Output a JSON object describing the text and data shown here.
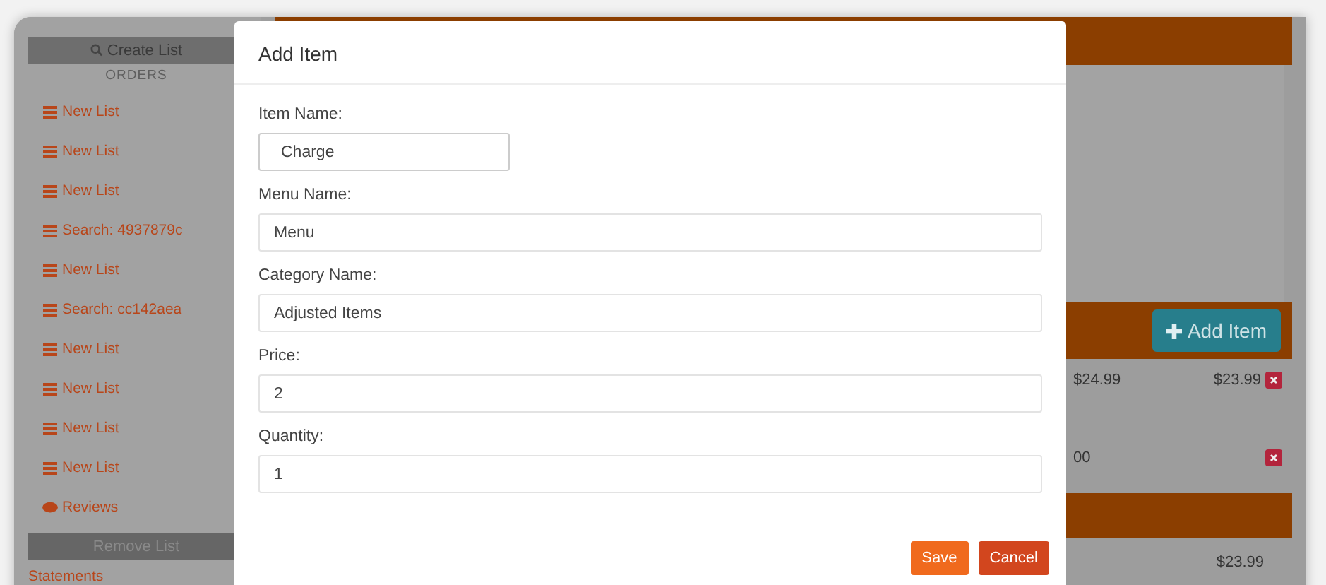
{
  "sidebar": {
    "create_button": "Create List",
    "section_heading": "ORDERS",
    "items": [
      {
        "kind": "list",
        "label": "New List"
      },
      {
        "kind": "list",
        "label": "New List"
      },
      {
        "kind": "list",
        "label": "New List"
      },
      {
        "kind": "list",
        "label": "Search: 4937879c"
      },
      {
        "kind": "list",
        "label": "New List"
      },
      {
        "kind": "list",
        "label": "Search: cc142aea"
      },
      {
        "kind": "list",
        "label": "New List"
      },
      {
        "kind": "list",
        "label": "New List"
      },
      {
        "kind": "list",
        "label": "New List"
      },
      {
        "kind": "list",
        "label": "New List"
      },
      {
        "kind": "reviews",
        "label": "Reviews"
      }
    ],
    "remove_button": "Remove List",
    "footer_link": "Statements"
  },
  "background": {
    "add_item_button": "Add Item",
    "rows": [
      {
        "price": "$24.99",
        "total": "$23.99"
      },
      {
        "price": "00",
        "total": ""
      }
    ],
    "summary_total": "$23.99"
  },
  "dialog": {
    "title": "Add Item",
    "fields": [
      {
        "label": "Item Name:",
        "value": "Charge",
        "narrow": true
      },
      {
        "label": "Menu Name:",
        "value": "Menu",
        "narrow": false
      },
      {
        "label": "Category Name:",
        "value": "Adjusted Items",
        "narrow": false
      },
      {
        "label": "Price:",
        "value": "2",
        "narrow": false
      },
      {
        "label": "Quantity:",
        "value": "1",
        "narrow": false
      }
    ],
    "buttons": [
      {
        "kind": "primary",
        "label": "Save"
      },
      {
        "kind": "danger",
        "label": "Cancel"
      }
    ]
  }
}
